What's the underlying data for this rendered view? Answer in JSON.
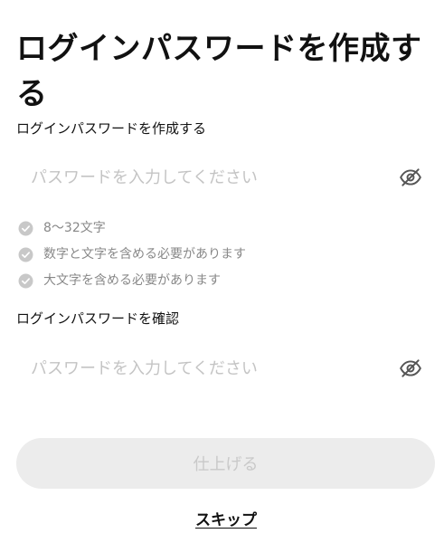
{
  "header": {
    "title": "ログインパスワードを作成する"
  },
  "password_field": {
    "label": "ログインパスワードを作成する",
    "value": "",
    "placeholder": "パスワードを入力してください",
    "toggle_icon": "eye-off-icon"
  },
  "requirements": [
    {
      "text": "8〜32文字",
      "status_icon": "check-circle-icon",
      "met": false
    },
    {
      "text": "数字と文字を含める必要があります",
      "status_icon": "check-circle-icon",
      "met": false
    },
    {
      "text": "大文字を含める必要があります",
      "status_icon": "check-circle-icon",
      "met": false
    }
  ],
  "confirm_field": {
    "label": "ログインパスワードを確認",
    "value": "",
    "placeholder": "パスワードを入力してください",
    "toggle_icon": "eye-off-icon"
  },
  "actions": {
    "submit_label": "仕上げる",
    "submit_enabled": false,
    "skip_label": "スキップ"
  },
  "colors": {
    "text_primary": "#111111",
    "text_secondary": "#888888",
    "placeholder": "#c4c4c4",
    "check_icon": "#c8c8c8",
    "button_disabled_bg": "#ececec",
    "button_disabled_text": "#c9c9c9"
  }
}
